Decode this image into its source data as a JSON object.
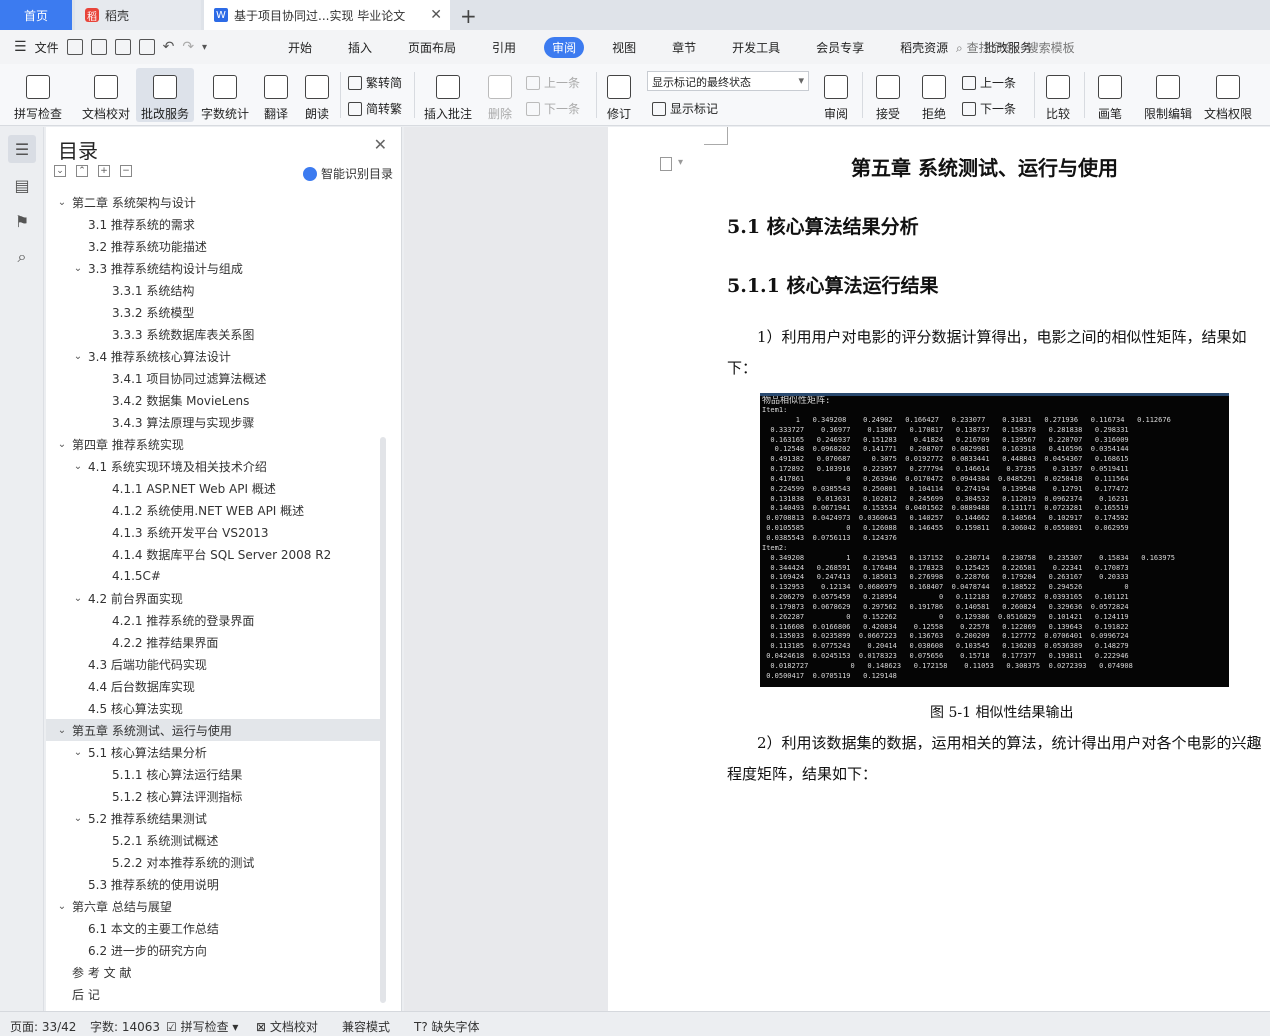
{
  "tabs": {
    "home": "首页",
    "daoke": "稻壳",
    "document": "基于项目协同过...实现 毕业论文"
  },
  "menu": {
    "file": "文件",
    "items": [
      "开始",
      "插入",
      "页面布局",
      "引用",
      "审阅",
      "视图",
      "章节",
      "开发工具",
      "会员专享",
      "稻壳资源",
      "批改服务"
    ],
    "active": "审阅",
    "search": "查找命令、搜索模板"
  },
  "ribbon": {
    "spell_check": "拼写检查",
    "doc_proof": "文档校对",
    "correction": "批改服务",
    "word_count": "字数统计",
    "translate": "翻译",
    "read_aloud": "朗读",
    "to_traditional": "繁转简",
    "to_simplified": "简转繁",
    "insert_comment": "插入批注",
    "delete": "删除",
    "prev": "上一条",
    "next": "下一条",
    "track": "修订",
    "markup_select": "显示标记的最终状态",
    "show_markup": "显示标记",
    "review": "审阅",
    "accept": "接受",
    "reject": "拒绝",
    "prev2": "上一条",
    "next2": "下一条",
    "compare": "比较",
    "pen": "画笔",
    "restrict_edit": "限制编辑",
    "doc_rights": "文档权限"
  },
  "toc": {
    "title": "目录",
    "smart": "智能识别目录",
    "items": [
      {
        "text": "第二章  系统架构与设计",
        "level": 1,
        "chev": "⌄"
      },
      {
        "text": "3.1 推荐系统的需求",
        "level": 2,
        "chev": ""
      },
      {
        "text": "3.2 推荐系统功能描述",
        "level": 2,
        "chev": ""
      },
      {
        "text": "3.3  推荐系统结构设计与组成",
        "level": 2,
        "chev": "⌄"
      },
      {
        "text": "3.3.1  系统结构",
        "level": 3,
        "chev": ""
      },
      {
        "text": "3.3.2  系统模型",
        "level": 3,
        "chev": ""
      },
      {
        "text": "3.3.3  系统数据库表关系图",
        "level": 3,
        "chev": ""
      },
      {
        "text": "3.4  推荐系统核心算法设计",
        "level": 2,
        "chev": "⌄"
      },
      {
        "text": "3.4.1  项目协同过滤算法概述",
        "level": 3,
        "chev": ""
      },
      {
        "text": "3.4.2 数据集 MovieLens",
        "level": 3,
        "chev": ""
      },
      {
        "text": "3.4.3 算法原理与实现步骤",
        "level": 3,
        "chev": ""
      },
      {
        "text": "第四章  推荐系统实现",
        "level": 1,
        "chev": "⌄"
      },
      {
        "text": "4.1  系统实现环境及相关技术介绍",
        "level": 2,
        "chev": "⌄"
      },
      {
        "text": "4.1.1 ASP.NET Web API 概述",
        "level": 3,
        "chev": ""
      },
      {
        "text": "4.1.2  系统使用.NET    WEB API 概述",
        "level": 3,
        "chev": ""
      },
      {
        "text": "4.1.3 系统开发平台  VS2013",
        "level": 3,
        "chev": ""
      },
      {
        "text": "4.1.4 数据库平台  SQL Server 2008 R2",
        "level": 3,
        "chev": ""
      },
      {
        "text": "4.1.5C#",
        "level": 3,
        "chev": ""
      },
      {
        "text": "4.2 前台界面实现",
        "level": 2,
        "chev": "⌄"
      },
      {
        "text": "4.2.1  推荐系统的登录界面",
        "level": 3,
        "chev": ""
      },
      {
        "text": "4.2.2  推荐结果界面",
        "level": 3,
        "chev": ""
      },
      {
        "text": "4.3  后端功能代码实现",
        "level": 2,
        "chev": ""
      },
      {
        "text": "4.4 后台数据库实现",
        "level": 2,
        "chev": ""
      },
      {
        "text": "4.5  核心算法实现",
        "level": 2,
        "chev": ""
      },
      {
        "text": "第五章  系统测试、运行与使用",
        "level": 1,
        "chev": "⌄",
        "selected": true
      },
      {
        "text": "5.1 核心算法结果分析",
        "level": 2,
        "chev": "⌄"
      },
      {
        "text": "5.1.1 核心算法运行结果",
        "level": 3,
        "chev": ""
      },
      {
        "text": "5.1.2 核心算法评测指标",
        "level": 3,
        "chev": ""
      },
      {
        "text": "5.2  推荐系统结果测试",
        "level": 2,
        "chev": "⌄"
      },
      {
        "text": "5.2.1  系统测试概述",
        "level": 3,
        "chev": ""
      },
      {
        "text": "5.2.2  对本推荐系统的测试",
        "level": 3,
        "chev": ""
      },
      {
        "text": "5.3  推荐系统的使用说明",
        "level": 2,
        "chev": ""
      },
      {
        "text": "第六章  总结与展望",
        "level": 1,
        "chev": "⌄"
      },
      {
        "text": "6.1  本文的主要工作总结",
        "level": 2,
        "chev": ""
      },
      {
        "text": "6.2  进一步的研究方向",
        "level": 2,
        "chev": ""
      },
      {
        "text": "参 考 文 献",
        "level": 1,
        "chev": ""
      },
      {
        "text": "后    记",
        "level": 1,
        "chev": ""
      }
    ]
  },
  "document": {
    "chapter_title": "第五章  系统测试、运行与使用",
    "section_title": "5.1 核心算法结果分析",
    "subsection_title": "5.1.1 核心算法运行结果",
    "para1": "1）利用用户对电影的评分数据计算得出，电影之间的相似性矩阵，结果如下：",
    "figure_header": "物品相似性矩阵:",
    "figure_lines": [
      "Item1:",
      "        1   0.349208    0.24902   0.166427   0.233077    0.31831   0.271936   0.116734   0.112676",
      "  0.333727    0.36977    0.13867   0.170817   0.138737   0.158378   0.281838   0.298331",
      "  0.163165   0.246937   0.151283    0.41824   0.216709   0.139567   0.220707   0.316009",
      "   0.12548  0.0968202   0.141771   0.208707  0.0829981   0.163918   0.416596  0.0354144",
      "  0.491382   0.070687     0.3075  0.0192772  0.0833441   0.448843  0.0454367   0.168615",
      "  0.172892   0.103916   0.223957   0.277794   0.146614    0.37335    0.31357  0.0519411",
      "  0.417861          0   0.263946  0.0170472  0.0944384  0.0485291  0.0250418   0.111564",
      "  0.224599  0.0385543   0.250801   0.104114   0.274194   0.139548    0.12791   0.177472",
      "  0.131838   0.013631   0.102812   0.245699   0.304532   0.112019  0.0962374    0.16231",
      "  0.140493  0.0671941   0.153534  0.0401562  0.0889488   0.131171  0.0723281   0.165519",
      " 0.0708813  0.0424973  0.0360643   0.140257   0.144662   0.140564   0.102917   0.174592",
      " 0.0105585          0   0.126088   0.146455   0.159811   0.306042  0.0550891   0.062959",
      " 0.0385543  0.0756113   0.124376",
      "Item2:",
      "  0.349208          1   0.219543   0.137152   0.230714   0.230758   0.235307    0.15834   0.163975",
      "  0.344424   0.268591   0.176484   0.178323   0.125425   0.226581    0.22341   0.170873",
      "  0.169424   0.247413   0.185013   0.276998   0.228766   0.179204   0.263167    0.20333",
      "  0.132953    0.12134  0.0686979   0.168407  0.0478744   0.188522   0.294526          0",
      "  0.206279  0.0575459   0.218954          0   0.112183   0.276852  0.0393165   0.101121",
      "  0.179873  0.0678629   0.297562   0.191786   0.140581   0.260824   0.329636  0.0572824",
      "  0.262287          0   0.152262          0   0.129386  0.0516829   0.101421   0.124119",
      "  0.116608  0.0166806   0.420834    0.12558    0.22578   0.122869   0.139643   0.191822",
      "  0.135033  0.0235899  0.0667223   0.136763   0.200209   0.127772  0.0706401  0.0996724",
      "  0.113185  0.0775243    0.20414   0.038608   0.103545   0.136203  0.0536389   0.148279",
      " 0.0424618  0.0245153  0.0178323   0.075656    0.15718   0.177377   0.193811   0.222946",
      "  0.0182727          0   0.148623   0.172158    0.11053   0.308375  0.0272393   0.074908",
      " 0.0500417  0.0705119   0.129148"
    ],
    "caption": "图 5-1  相似性结果输出",
    "para2": "2）利用该数据集的数据，运用相关的算法，统计得出用户对各个电影的兴趣程度矩阵，结果如下："
  },
  "status": {
    "page": "页面: 33/42",
    "words": "字数: 14063",
    "spell": "拼写检查",
    "proof": "文档校对",
    "compat": "兼容模式",
    "missing_font": "缺失字体"
  }
}
